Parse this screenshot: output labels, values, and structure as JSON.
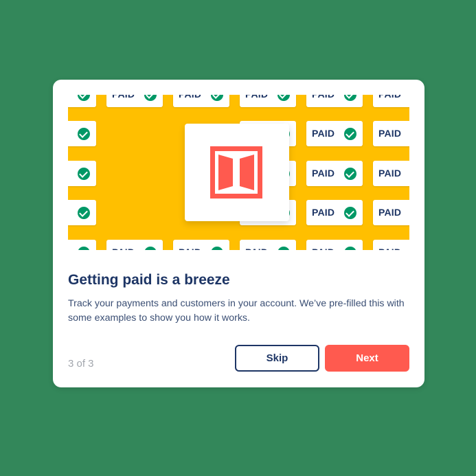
{
  "hero": {
    "tile_label": "PAID",
    "logo_icon": "brand-logo-icon",
    "accent_color": "#ffbf00",
    "check_color": "#009866",
    "logo_color": "#ff5a4f"
  },
  "onboarding": {
    "title": "Getting paid is a breeze",
    "description": "Track your payments and customers in your account.  We’ve pre-filled this with some examples to show you how it works.",
    "progress": "3 of 3"
  },
  "buttons": {
    "skip_label": "Skip",
    "next_label": "Next"
  },
  "colors": {
    "background": "#33875a",
    "primary_text": "#1d3565",
    "next_button": "#ff5a4f"
  }
}
